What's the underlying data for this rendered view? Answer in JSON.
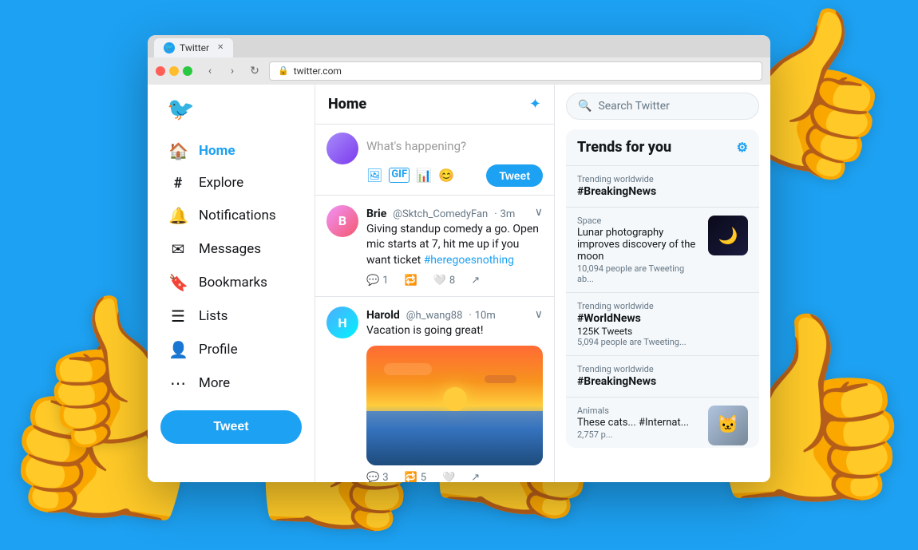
{
  "background_color": "#1da1f2",
  "browser": {
    "tab_label": "Twitter",
    "url": "twitter.com",
    "favicon_color": "#1da1f2"
  },
  "sidebar": {
    "logo": "🐦",
    "nav_items": [
      {
        "id": "home",
        "label": "Home",
        "icon": "🏠",
        "active": true
      },
      {
        "id": "explore",
        "label": "Explore",
        "icon": "#",
        "active": false
      },
      {
        "id": "notifications",
        "label": "Notifications",
        "icon": "🔔",
        "active": false
      },
      {
        "id": "messages",
        "label": "Messages",
        "icon": "✉️",
        "active": false
      },
      {
        "id": "bookmarks",
        "label": "Bookmarks",
        "icon": "🔖",
        "active": false
      },
      {
        "id": "lists",
        "label": "Lists",
        "icon": "📋",
        "active": false
      },
      {
        "id": "profile",
        "label": "Profile",
        "icon": "👤",
        "active": false
      },
      {
        "id": "more",
        "label": "More",
        "icon": "⋯",
        "active": false
      }
    ],
    "tweet_button": "Tweet"
  },
  "feed": {
    "title": "Home",
    "compose_placeholder": "What's happening?",
    "tweet_button": "Tweet",
    "tweets": [
      {
        "author": "Brie",
        "handle": "@Sktch_ComedyFan",
        "time": "3m",
        "text": "Giving standup comedy a go. Open mic starts at 7, hit me up if you want ticket",
        "link": "#heregoesnothing",
        "reply_count": "1",
        "retweet_count": "",
        "like_count": "8"
      },
      {
        "author": "Harold",
        "handle": "@h_wang88",
        "time": "10m",
        "text": "Vacation is going great!",
        "reply_count": "3",
        "retweet_count": "5",
        "like_count": ""
      }
    ]
  },
  "trends": {
    "title": "Trends for you",
    "search_placeholder": "Search Twitter",
    "items": [
      {
        "category": "Trending worldwide",
        "hashtag": "#BreakingNews",
        "count": "",
        "has_image": false
      },
      {
        "category": "Space",
        "hashtag": "",
        "text": "Lunar photography improves discovery of the moon",
        "count": "10,094 people are Tweeting ab...",
        "has_image": true,
        "image_type": "dark"
      },
      {
        "category": "Trending worldwide",
        "hashtag": "#WorldNews",
        "sub": "125K Tweets",
        "count": "5,094 people are Tweeting...",
        "has_image": false
      },
      {
        "category": "Trending worldwide",
        "hashtag": "#BreakingNews",
        "count": "",
        "has_image": false
      },
      {
        "category": "Animals",
        "text": "These cats... #Internat...",
        "count": "2,757 p...",
        "has_image": true,
        "image_type": "cat"
      }
    ]
  }
}
